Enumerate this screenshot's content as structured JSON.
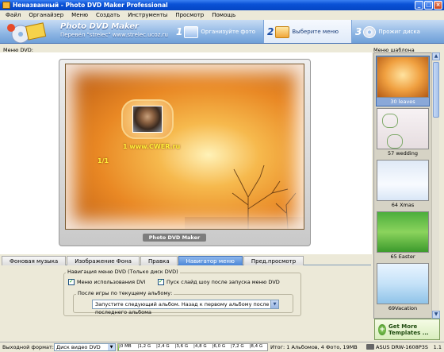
{
  "window": {
    "title": "Неназванный - Photo DVD Maker Professional"
  },
  "menu": [
    "Файл",
    "Органайзер",
    "Меню",
    "Создать",
    "Инструменты",
    "Просмотр",
    "Помощь"
  ],
  "header": {
    "title": "Photo DVD Maker",
    "subtitle": "Перевёл \"strelec\" www.strelec.ucoz.ru",
    "steps": [
      {
        "num": "1",
        "label": "Организуйте фото",
        "active": false
      },
      {
        "num": "2",
        "label": "Выберите меню",
        "active": true
      },
      {
        "num": "3",
        "label": "Прожиг диска",
        "active": false
      }
    ]
  },
  "main": {
    "menu_label": "Меню DVD:",
    "preview": {
      "url_text": "1  www.CWER.ru",
      "pager": "1/1",
      "caption": "Photo DVD Maker"
    }
  },
  "templates": {
    "label": "Меню шаблона",
    "items": [
      {
        "name": "30 leaves",
        "selected": true
      },
      {
        "name": "57 wedding",
        "selected": false
      },
      {
        "name": "64 Xmas",
        "selected": false
      },
      {
        "name": "65 Easter",
        "selected": false
      },
      {
        "name": "69Vacation",
        "selected": false
      }
    ],
    "get_more": "Get More Templates ..."
  },
  "tabs": [
    {
      "label": "Фоновая музыка",
      "active": false
    },
    {
      "label": "Изображение Фона",
      "active": false
    },
    {
      "label": "Правка",
      "active": false
    },
    {
      "label": "Навигатор меню",
      "active": true
    },
    {
      "label": "Пред.просмотр",
      "active": false
    }
  ],
  "nav_panel": {
    "group_title": "Навигация меню DVD (Только диск DVD)",
    "checkbox1": "Меню использования DVI",
    "checkbox2": "Пуск слайд шоу после запуска меню DVD",
    "subgroup_title": "После игры по текущему альбому:",
    "select_value": "Запустите следующий альбом. Назад к первому альбому после последнего альбома"
  },
  "status": {
    "output_label": "Выходной формат:",
    "output_value": "Диск видео DVD",
    "ticks": [
      "0 MB",
      "1,2 G",
      "2,4 G",
      "3,6 G",
      "4,8 G",
      "6,0 G",
      "7,2 G",
      "8,4 G"
    ],
    "capacity_fraction": 0.004,
    "total": "Итог: 1 Альбомов, 4 Фото, 19MB",
    "drive": "ASUS     DRW-1608P3S",
    "version": "1.1"
  },
  "colors": {
    "accent": "#3d6db5",
    "preview_orange": "#e98824",
    "text_yellow": "#ffef3a"
  }
}
